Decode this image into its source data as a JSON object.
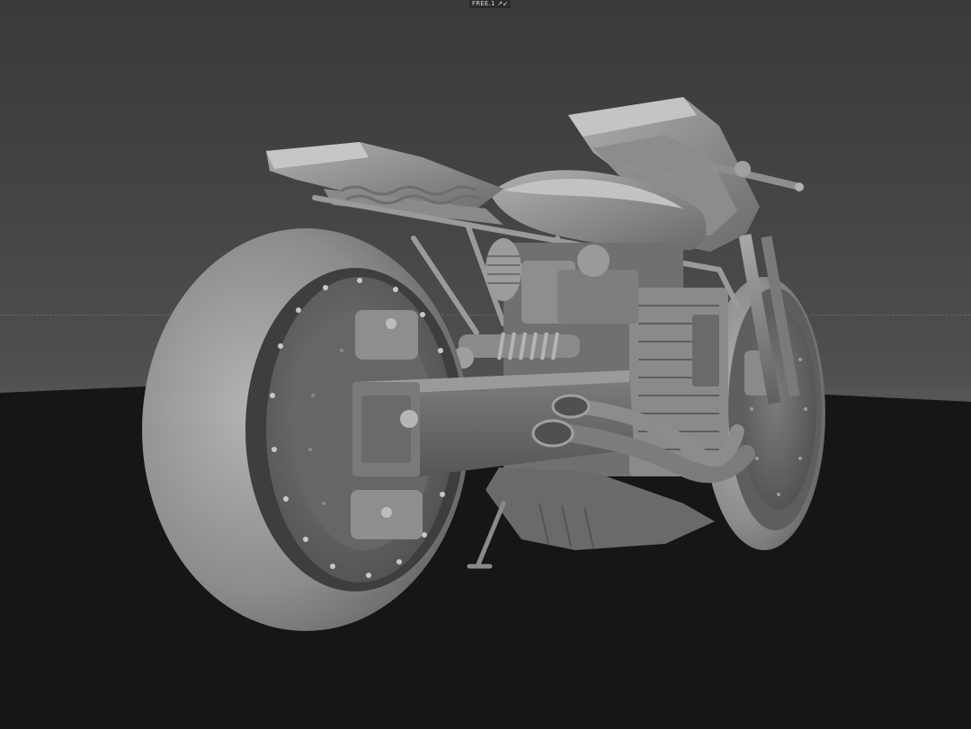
{
  "viewport": {
    "camera_label": "FREE.1",
    "camera_icon": "camera-arrows-icon",
    "background_top_color": "#3a3a3a",
    "background_horizon_color": "#555555",
    "floor_color": "#161616"
  },
  "model": {
    "icon": "motorcycle-model-icon",
    "shading": "clay-grey"
  }
}
